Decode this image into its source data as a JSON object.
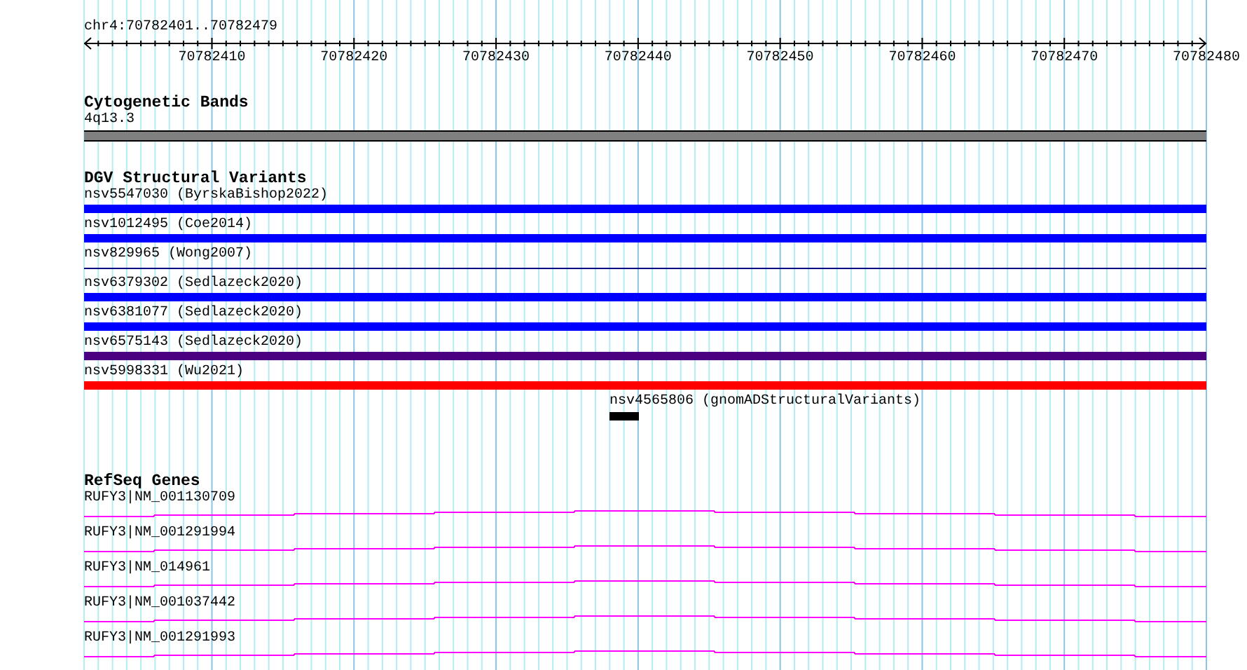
{
  "location": "chr4:70782401..70782479",
  "ruler": {
    "ticks": [
      "70782410",
      "70782420",
      "70782430",
      "70782440",
      "70782450",
      "70782460",
      "70782470",
      "70782480"
    ]
  },
  "tracks": [
    {
      "kind": "bands",
      "title": "Cytogenetic Bands",
      "features": [
        {
          "label": "4q13.3"
        }
      ]
    },
    {
      "kind": "variants",
      "title": "DGV Structural Variants",
      "features": [
        {
          "label": "nsv5547030 (ByrskaBishop2022)",
          "kind": "bar",
          "color": "#0000ff"
        },
        {
          "label": "nsv1012495 (Coe2014)",
          "kind": "bar",
          "color": "#0000ff"
        },
        {
          "label": "nsv829965 (Wong2007)",
          "kind": "line",
          "color": "#000080"
        },
        {
          "label": "nsv6379302 (Sedlazeck2020)",
          "kind": "bar",
          "color": "#0000ff"
        },
        {
          "label": "nsv6381077 (Sedlazeck2020)",
          "kind": "bar",
          "color": "#0000ff"
        },
        {
          "label": "nsv6575143 (Sedlazeck2020)",
          "kind": "bar",
          "color": "#4b0082"
        },
        {
          "label": "nsv5998331 (Wu2021)",
          "kind": "bar",
          "color": "#ff0000"
        },
        {
          "label": "nsv4565806 (gnomADStructuralVariants)",
          "kind": "marker",
          "color": "#000000"
        }
      ]
    },
    {
      "kind": "genes",
      "title": "RefSeq Genes",
      "features": [
        {
          "label": "RUFY3|NM_001130709"
        },
        {
          "label": "RUFY3|NM_001291994"
        },
        {
          "label": "RUFY3|NM_014961"
        },
        {
          "label": "RUFY3|NM_001037442"
        },
        {
          "label": "RUFY3|NM_001291993"
        }
      ]
    }
  ]
}
